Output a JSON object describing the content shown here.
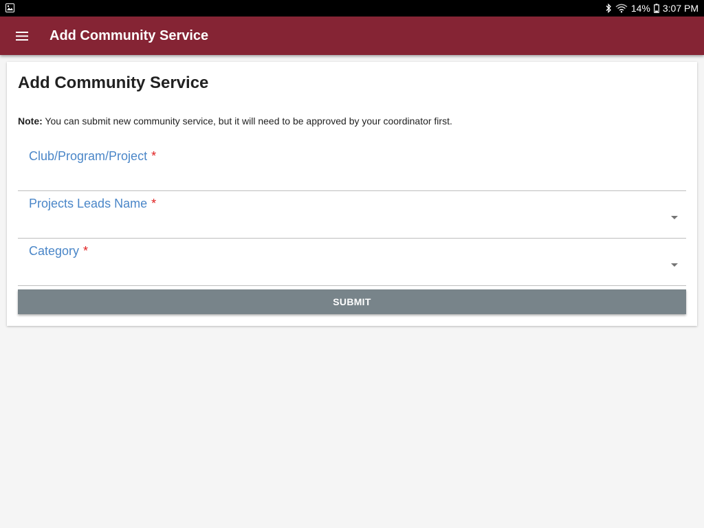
{
  "status_bar": {
    "battery": "14%",
    "time": "3:07 PM",
    "icons": [
      "image-icon",
      "bluetooth-icon",
      "wifi-icon",
      "battery-icon"
    ]
  },
  "app_bar": {
    "title": "Add Community Service",
    "background": "#852434"
  },
  "form": {
    "title": "Add Community Service",
    "note_label": "Note:",
    "note_text": " You can submit new community service, but it will need to be approved by your coordinator first.",
    "fields": [
      {
        "label": "Club/Program/Project",
        "required_mark": "*",
        "value": ""
      },
      {
        "label": "Projects Leads Name",
        "required_mark": "*",
        "value": ""
      },
      {
        "label": "Category",
        "required_mark": "*",
        "value": ""
      }
    ],
    "submit_label": "SUBMIT"
  }
}
